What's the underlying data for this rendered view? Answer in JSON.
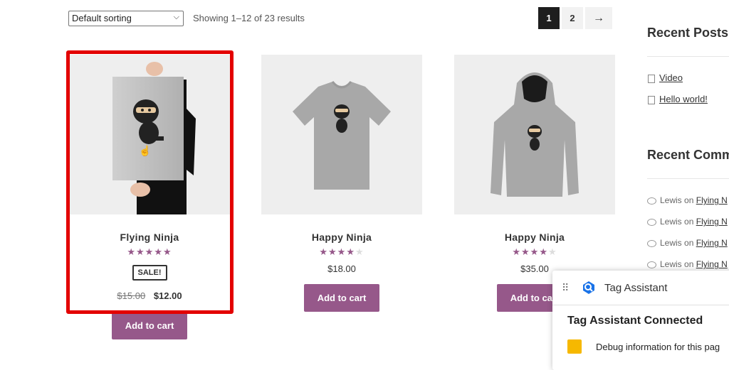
{
  "toolbar": {
    "sort_selected": "Default sorting",
    "result_count": "Showing 1–12 of 23 results"
  },
  "pagination": {
    "pages": [
      "1",
      "2"
    ],
    "current": "1",
    "next": "→"
  },
  "products": [
    {
      "title": "Flying Ninja",
      "rating": 4.5,
      "sale_badge": "SALE!",
      "old_price": "$15.00",
      "price": "$12.00",
      "cart_label": "Add to cart"
    },
    {
      "title": "Happy Ninja",
      "rating": 4,
      "price": "$18.00",
      "cart_label": "Add to cart"
    },
    {
      "title": "Happy Ninja",
      "rating": 3.5,
      "price": "$35.00",
      "cart_label": "Add to cart"
    }
  ],
  "sidebar": {
    "recent_posts_title": "Recent Posts",
    "posts": [
      "Video",
      "Hello world!"
    ],
    "recent_comments_title": "Recent Comm",
    "comments": [
      {
        "author": "Lewis",
        "on": "on",
        "link": "Flying N"
      },
      {
        "author": "Lewis",
        "on": "on",
        "link": "Flying N"
      },
      {
        "author": "Lewis",
        "on": "on",
        "link": "Flying N"
      },
      {
        "author": "Lewis",
        "on": "on",
        "link": "Flying N"
      }
    ]
  },
  "tag_assistant": {
    "title": "Tag Assistant",
    "status": "Tag Assistant Connected",
    "debug_text": "Debug information for this pag"
  },
  "colors": {
    "accent": "#96588a",
    "highlight": "#e30000",
    "ta_yellow": "#f6b800",
    "ta_blue": "#1a73e8"
  }
}
